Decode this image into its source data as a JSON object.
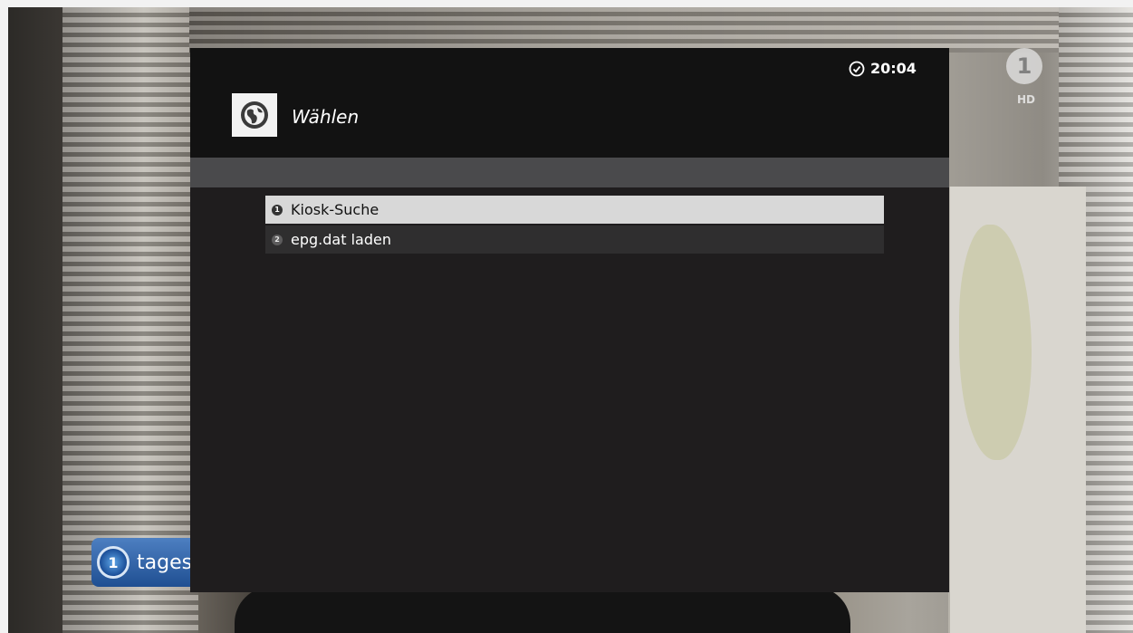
{
  "overlay": {
    "channel_logo": "1",
    "channel_hd": "HD",
    "program_bug_text": "tages",
    "program_bug_icon": "1"
  },
  "dialog": {
    "time": "20:04",
    "title": "Wählen",
    "icon": "globe-icon",
    "items": [
      {
        "number": "1",
        "label": "Kiosk-Suche",
        "selected": true
      },
      {
        "number": "2",
        "label": "epg.dat laden",
        "selected": false
      }
    ]
  },
  "colors": {
    "header_bg": "#121212",
    "dialog_bg": "#1f1d1e",
    "subheader_bg": "#4a4a4c",
    "selected_bg": "#d8d8d8",
    "item_bg": "#2f2e2f"
  }
}
